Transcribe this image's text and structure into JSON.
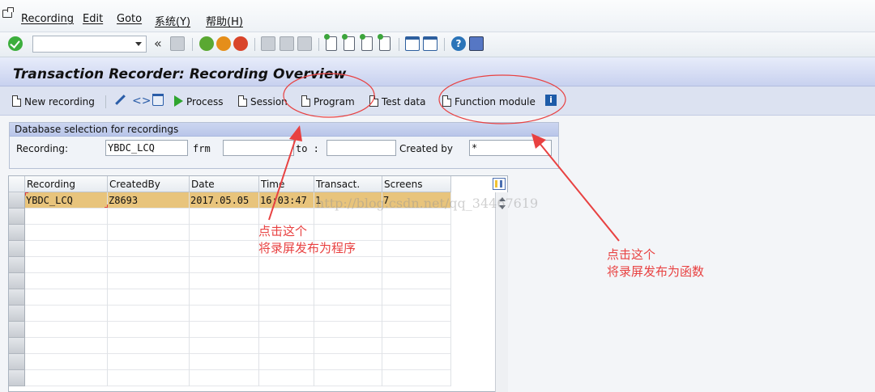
{
  "menubar": {
    "items": [
      "Recording",
      "Edit",
      "Goto",
      "系统(Y)",
      "帮助(H)"
    ]
  },
  "toolbar": {
    "command_field_value": "",
    "icons": [
      "enter-icon",
      "save-icon",
      "back-icon",
      "exit-icon",
      "cancel-icon",
      "print-icon",
      "find-icon",
      "find-next-icon",
      "first-page-icon",
      "previous-page-icon",
      "next-page-icon",
      "last-page-icon",
      "new-session-icon",
      "shortcut-icon",
      "help-icon",
      "customize-layout-icon"
    ]
  },
  "title": "Transaction Recorder: Recording Overview",
  "app_toolbar": {
    "new_recording": "New recording",
    "process": "Process",
    "session": "Session",
    "program": "Program",
    "test_data": "Test data",
    "function_module": "Function module"
  },
  "selection": {
    "group_title": "Database selection for recordings",
    "recording_label": "Recording:",
    "recording_value": "YBDC_LCQ",
    "from_label": "frm",
    "from_value": "",
    "to_label": "to :",
    "to_value": "",
    "created_by_label": "Created by",
    "created_by_value": "*"
  },
  "table": {
    "columns": [
      "Recording",
      "CreatedBy",
      "Date",
      "Time",
      "Transact.",
      "Screens"
    ],
    "rows": [
      {
        "recording": "YBDC_LCQ",
        "created_by": "Z8693",
        "date": "2017.05.05",
        "time": "16:03:47",
        "transactions": "1",
        "screens": "7"
      }
    ]
  },
  "watermark": "http://blog.csdn.net/qq_34467619",
  "annotations": {
    "left": {
      "line1": "点击这个",
      "line2": "将录屏发布为程序"
    },
    "right": {
      "line1": "点击这个",
      "line2": "将录屏发布为函数"
    }
  },
  "colors": {
    "annotation_red": "#e84141",
    "selected_row": "#e8c47c",
    "title_band": "#c8d1ef"
  }
}
